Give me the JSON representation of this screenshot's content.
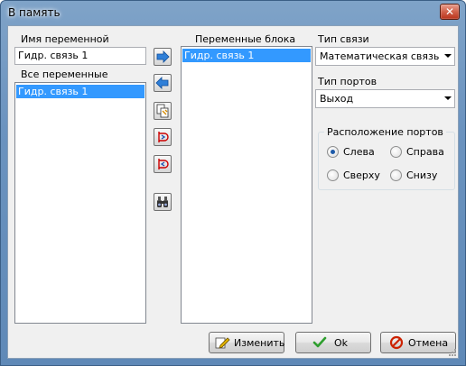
{
  "window": {
    "title": "В память",
    "close_glyph": "✕"
  },
  "left": {
    "var_name_label": "Имя переменной",
    "var_name_value": "Гидр. связь 1",
    "all_vars_label": "Все переменные",
    "all_vars_items": [
      "Гидр. связь 1"
    ]
  },
  "middle": {
    "block_vars_label": "Переменные блока",
    "block_vars_items": [
      "Гидр. связь 1"
    ]
  },
  "toolbar": {
    "icons": [
      "arrow-right-icon",
      "arrow-left-icon",
      "copy-edit-icon",
      "port-connect-icon",
      "port-disconnect-icon",
      "binoculars-icon"
    ]
  },
  "right": {
    "link_type_label": "Тип связи",
    "link_type_value": "Математическая связь",
    "port_type_label": "Тип портов",
    "port_type_value": "Выход",
    "port_pos_title": "Расположение портов",
    "port_pos_options": [
      "Слева",
      "Справа",
      "Сверху",
      "Снизу"
    ],
    "port_pos_selected": "Слева"
  },
  "buttons": {
    "edit_label": "Изменить",
    "ok_label": "Ok",
    "cancel_label": "Отмена"
  },
  "colors": {
    "selection": "#3399ff",
    "ok_check": "#2e9e2e",
    "cancel_red": "#cc2200"
  }
}
